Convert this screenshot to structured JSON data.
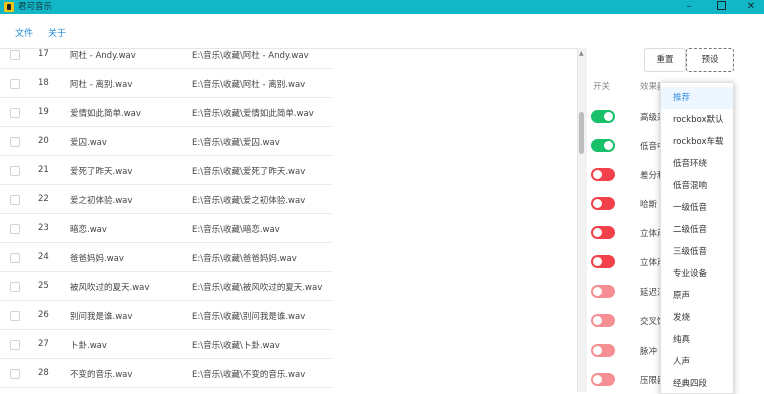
{
  "window": {
    "title": "君可音乐"
  },
  "menu": {
    "file": "文件",
    "about": "关于"
  },
  "songs": [
    {
      "num": "17",
      "name": "阿杜 - Andy.wav",
      "path": "E:\\音乐\\收藏\\阿杜 - Andy.wav"
    },
    {
      "num": "18",
      "name": "阿杜 - 离别.wav",
      "path": "E:\\音乐\\收藏\\阿杜 - 离别.wav"
    },
    {
      "num": "19",
      "name": "爱情如此简单.wav",
      "path": "E:\\音乐\\收藏\\爱情如此简单.wav"
    },
    {
      "num": "20",
      "name": "爱囚.wav",
      "path": "E:\\音乐\\收藏\\爱囚.wav"
    },
    {
      "num": "21",
      "name": "爱死了昨天.wav",
      "path": "E:\\音乐\\收藏\\爱死了昨天.wav"
    },
    {
      "num": "22",
      "name": "爱之初体验.wav",
      "path": "E:\\音乐\\收藏\\爱之初体验.wav"
    },
    {
      "num": "23",
      "name": "暗恋.wav",
      "path": "E:\\音乐\\收藏\\暗恋.wav"
    },
    {
      "num": "24",
      "name": "爸爸妈妈.wav",
      "path": "E:\\音乐\\收藏\\爸爸妈妈.wav"
    },
    {
      "num": "25",
      "name": "被风吹过的夏天.wav",
      "path": "E:\\音乐\\收藏\\被风吹过的夏天.wav"
    },
    {
      "num": "26",
      "name": "别问我是谁.wav",
      "path": "E:\\音乐\\收藏\\别问我是谁.wav"
    },
    {
      "num": "27",
      "name": "卜卦.wav",
      "path": "E:\\音乐\\收藏\\卜卦.wav"
    },
    {
      "num": "28",
      "name": "不变的音乐.wav",
      "path": "E:\\音乐\\收藏\\不变的音乐.wav"
    }
  ],
  "effects_panel": {
    "reset_label": "重置",
    "preset_label": "预设",
    "col_switch": "开关",
    "col_effect": "效果器",
    "rows": [
      {
        "label": "高级采",
        "on": true
      },
      {
        "label": "低音中",
        "on": true
      },
      {
        "label": "差分和",
        "on": false
      },
      {
        "label": "哈斯",
        "on": false
      },
      {
        "label": "立体声",
        "on": false
      },
      {
        "label": "立体声",
        "on": false
      },
      {
        "label": "延迟混",
        "on": false
      },
      {
        "label": "交叉馈",
        "on": false
      },
      {
        "label": "脉冲",
        "on": false
      },
      {
        "label": "压限器",
        "on": false
      }
    ]
  },
  "preset_options": [
    "推荐",
    "rockbox默认",
    "rockbox车载",
    "低音环绕",
    "低音混响",
    "一级低音",
    "二级低音",
    "三级低音",
    "专业设备",
    "原声",
    "发烧",
    "纯真",
    "人声",
    "经典四段"
  ],
  "preset_selected": "推荐",
  "colors": {
    "accent": "#12b7c7",
    "toggle_on": "#18c06a",
    "toggle_off_dark": "#f2414a",
    "toggle_off_light": "#f68f93",
    "menu_link": "#1e88d6"
  }
}
